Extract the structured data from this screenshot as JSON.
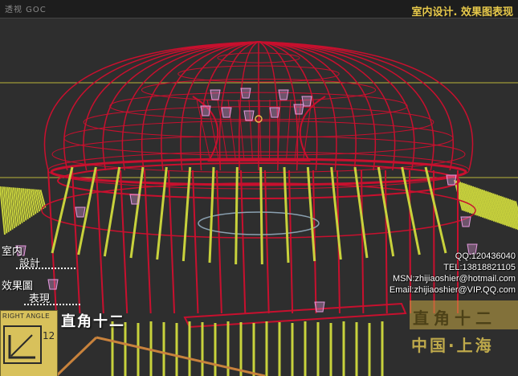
{
  "viewport": {
    "label": "透视 GOC",
    "background": "#2e2e2e"
  },
  "header": {
    "brand_title": "室内设计. 效果图表现"
  },
  "contact": {
    "qq": "QQ:120436040",
    "tel": "TEL:13818821105",
    "msn": "MSN:zhijiaoshier@hotmail.com",
    "email": "Email:zhijiaoshier@VIP.QQ.com"
  },
  "side_labels": {
    "line1": "室内",
    "line2": "設計",
    "line3": "效果圖",
    "line4": "表現"
  },
  "logo": {
    "right_angle": "RIGHT ANGLE",
    "number": "12",
    "title": "直角十二"
  },
  "watermark": {
    "name": "直角十二",
    "city": "中国·上海"
  },
  "colors": {
    "wire_red": "#c8102e",
    "wire_yellow": "#c8d23c",
    "wire_pink": "#e59adf",
    "accent": "#e6c84a"
  }
}
